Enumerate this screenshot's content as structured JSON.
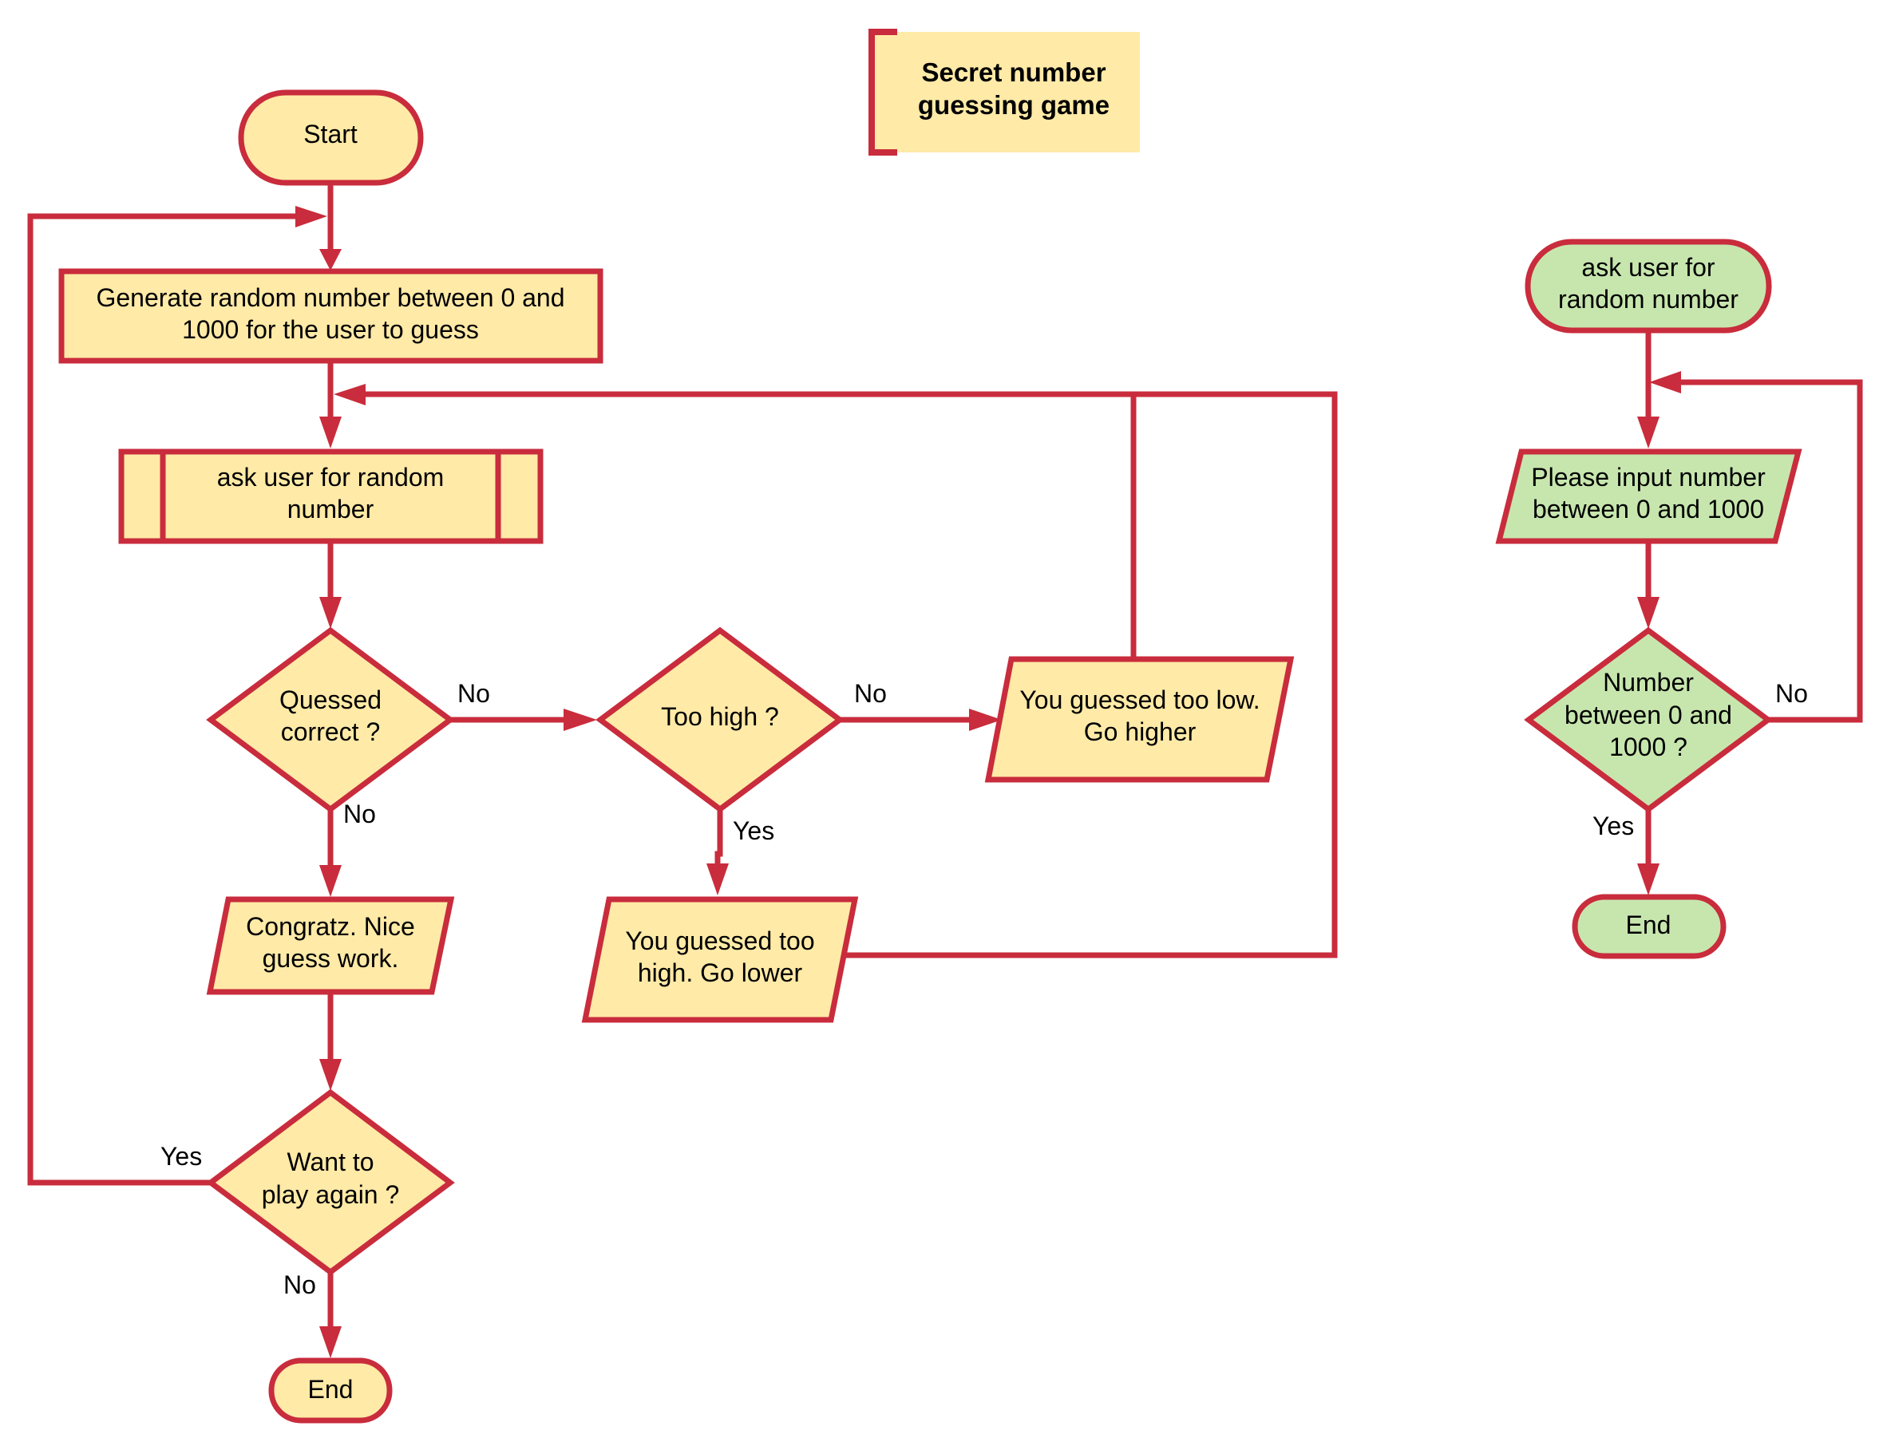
{
  "title": {
    "line1": "Secret number",
    "line2": "guessing game"
  },
  "colors": {
    "stroke": "#c92c3c",
    "main_fill": "#ffeaa7",
    "sub_fill": "#c7e6ae"
  },
  "main_flow": {
    "start": "Start",
    "generate": {
      "line1": "Generate random number between 0 and",
      "line2": "1000 for the user to guess"
    },
    "ask_subroutine": {
      "line1": "ask user for random",
      "line2": "number"
    },
    "decision_correct": {
      "line1": "Quessed",
      "line2": "correct ?"
    },
    "decision_too_high": {
      "line1": "Too high ?"
    },
    "output_too_low": {
      "line1": "You guessed too low.",
      "line2": "Go higher"
    },
    "output_congratz": {
      "line1": "Congratz. Nice",
      "line2": "guess work."
    },
    "output_too_high": {
      "line1": "You guessed too",
      "line2": "high. Go lower"
    },
    "decision_play_again": {
      "line1": "Want to",
      "line2": "play again ?"
    },
    "end": "End",
    "edge_labels": {
      "correct_to_too_high": "No",
      "correct_to_congratz": "No",
      "too_high_to_low": "No",
      "too_high_to_high": "Yes",
      "play_again_yes": "Yes",
      "play_again_no": "No"
    }
  },
  "sub_flow": {
    "start": {
      "line1": "ask user for",
      "line2": "random number"
    },
    "input": {
      "line1": "Please input number",
      "line2": "between 0 and 1000"
    },
    "decision": {
      "line1": "Number",
      "line2": "between 0 and",
      "line3": "1000 ?"
    },
    "end": "End",
    "edge_labels": {
      "decision_no": "No",
      "decision_yes": "Yes"
    }
  }
}
